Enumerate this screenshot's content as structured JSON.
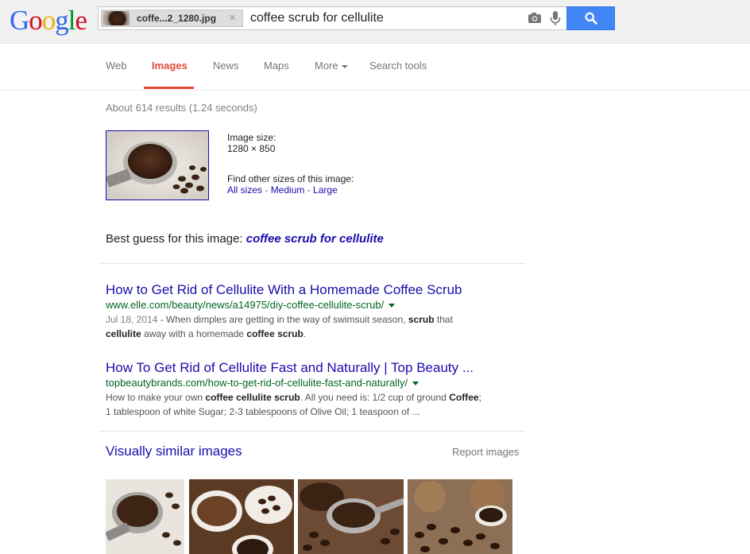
{
  "header": {
    "logo_letters": [
      "G",
      "o",
      "o",
      "g",
      "l",
      "e"
    ],
    "image_chip_name": "coffe...2_1280.jpg",
    "chip_close": "×",
    "query": "coffee scrub for cellulite"
  },
  "tabs": [
    {
      "label": "Web"
    },
    {
      "label": "Images",
      "active": true
    },
    {
      "label": "News"
    },
    {
      "label": "Maps"
    },
    {
      "label": "More"
    },
    {
      "label": "Search tools"
    }
  ],
  "results_stats": "About 614 results (1.24 seconds)",
  "image_info": {
    "size_label": "Image size:",
    "size_value": "1280 × 850",
    "other_sizes_label": "Find other sizes of this image:",
    "links": [
      "All sizes",
      "Medium",
      "Large"
    ],
    "separator": " - "
  },
  "best_guess": {
    "label": "Best guess for this image:",
    "value": "coffee scrub for cellulite"
  },
  "results": [
    {
      "title": "How to Get Rid of Cellulite With a Homemade Coffee Scrub",
      "url": "www.elle.com/beauty/news/a14975/diy-coffee-cellulite-scrub/",
      "date": "Jul 18, 2014",
      "snippet_parts": [
        " - When dimples are getting in the way of swimsuit season, ",
        "scrub",
        " that ",
        "cellulite",
        " away with a homemade ",
        "coffee scrub",
        "."
      ]
    },
    {
      "title": "How To Get Rid of Cellulite Fast and Naturally | Top Beauty ...",
      "url": "topbeautybrands.com/how-to-get-rid-of-cellulite-fast-and-naturally/",
      "snippet_parts": [
        "How to make your own ",
        "coffee cellulite scrub",
        ". All you need is: 1/2 cup of ground ",
        "Coffee",
        ";",
        "1 tablespoon of white Sugar; 2-3 tablespoons of Olive Oil; 1 teaspoon of ..."
      ]
    }
  ],
  "similar": {
    "title": "Visually similar images",
    "report": "Report images"
  },
  "colors": {
    "link": "#1a0dab",
    "url_green": "#006621",
    "active_tab": "#dd4b39",
    "search_button": "#4285f4"
  },
  "icons": [
    "camera-icon",
    "microphone-icon",
    "search-icon",
    "close-icon",
    "chevron-down-icon"
  ]
}
